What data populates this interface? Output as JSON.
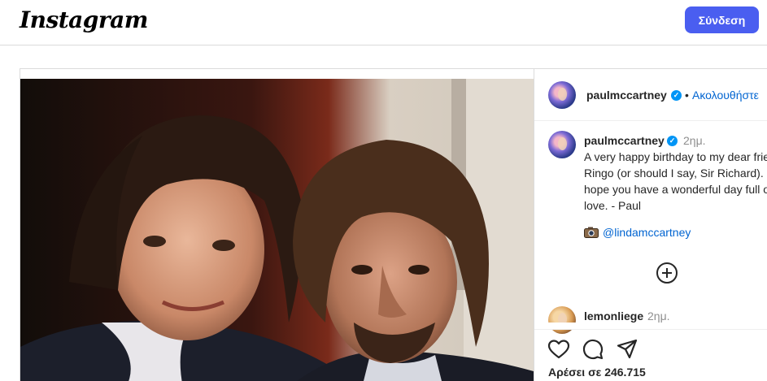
{
  "header": {
    "logo_text": "Instagram",
    "login_label": "Σύνδεση"
  },
  "post": {
    "author": "paulmccartney",
    "follow_separator": "•",
    "follow_label": "Ακολουθήστε",
    "caption": {
      "author": "paulmccartney",
      "time": "2ημ.",
      "text": "A very happy birthday to my dear friend, Ringo (or should I say, Sir Richard). I hope you have a wonderful day full of love. - Paul",
      "photo_credit_icon": "camera-icon",
      "photo_credit_mention": "@lindamccartney"
    },
    "comments": [
      {
        "author": "lemonliege",
        "time": "2ημ."
      }
    ],
    "actions": {
      "icons": [
        "heart-icon",
        "comment-icon",
        "share-icon"
      ]
    },
    "likes_text": "Αρέσει σε 246.715"
  },
  "colors": {
    "primary_button": "#4a5ef0",
    "link": "#0064d1",
    "verified": "#0095f6"
  }
}
